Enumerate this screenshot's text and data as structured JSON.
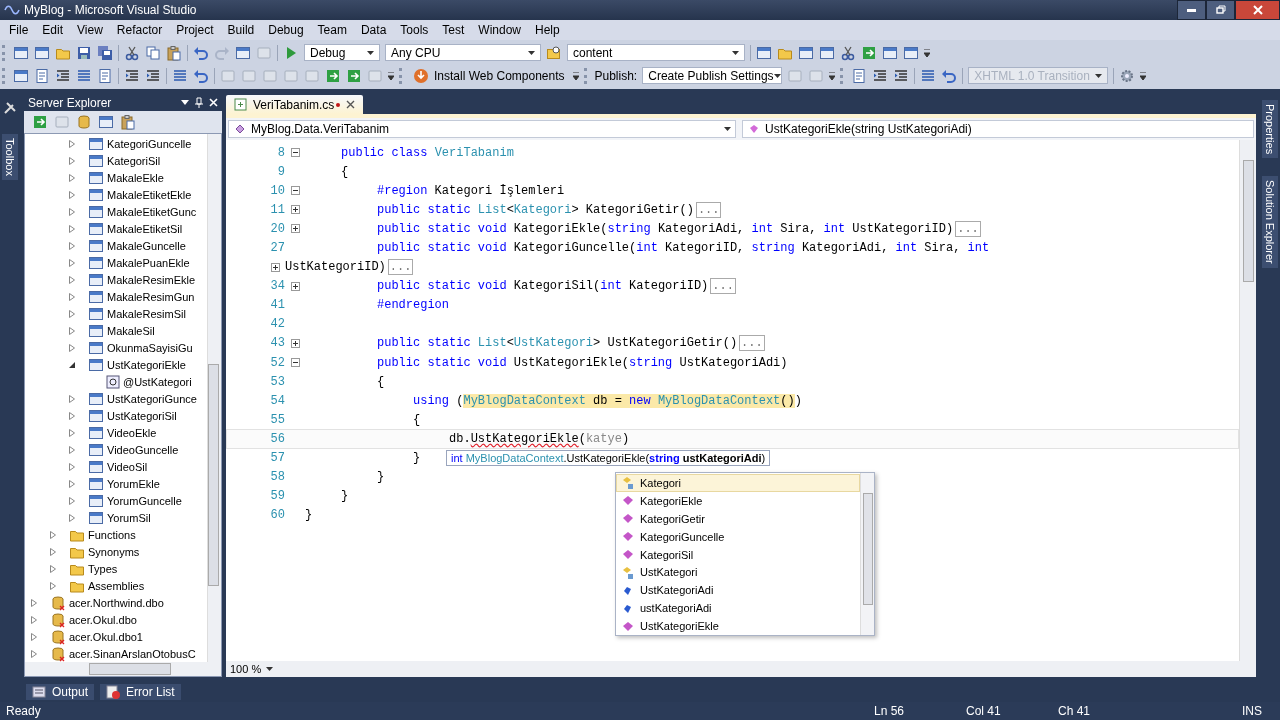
{
  "window": {
    "title": "MyBlog - Microsoft Visual Studio"
  },
  "menu": [
    "File",
    "Edit",
    "View",
    "Refactor",
    "Project",
    "Build",
    "Debug",
    "Team",
    "Data",
    "Tools",
    "Test",
    "Window",
    "Help"
  ],
  "toolbar": {
    "configuration": "Debug",
    "platform": "Any CPU",
    "find": "content",
    "install_button": "Install Web Components",
    "publish_label": "Publish:",
    "publish_settings": "Create Publish Settings",
    "doctype": {
      "value": "XHTML 1.0 Transition",
      "disabled": true
    }
  },
  "side_tabs": {
    "left": [
      "Toolbox"
    ],
    "right": [
      "Properties",
      "Solution Explorer"
    ]
  },
  "server_explorer": {
    "title": "Server Explorer",
    "procedures": [
      {
        "label": "KategoriGuncelle",
        "expanded": false
      },
      {
        "label": "KategoriSil",
        "expanded": false
      },
      {
        "label": "MakaleEkle",
        "expanded": false
      },
      {
        "label": "MakaleEtiketEkle",
        "expanded": false
      },
      {
        "label": "MakaleEtiketGunc",
        "expanded": false
      },
      {
        "label": "MakaleEtiketSil",
        "expanded": false
      },
      {
        "label": "MakaleGuncelle",
        "expanded": false
      },
      {
        "label": "MakalePuanEkle",
        "expanded": false
      },
      {
        "label": "MakaleResimEkle",
        "expanded": false
      },
      {
        "label": "MakaleResimGun",
        "expanded": false
      },
      {
        "label": "MakaleResimSil",
        "expanded": false
      },
      {
        "label": "MakaleSil",
        "expanded": false
      },
      {
        "label": "OkunmaSayisiGu",
        "expanded": false
      },
      {
        "label": "UstKategoriEkle",
        "expanded": true,
        "children": [
          {
            "label": "@UstKategori"
          }
        ]
      },
      {
        "label": "UstKategoriGunce",
        "expanded": false
      },
      {
        "label": "UstKategoriSil",
        "expanded": false
      },
      {
        "label": "VideoEkle",
        "expanded": false
      },
      {
        "label": "VideoGuncelle",
        "expanded": false
      },
      {
        "label": "VideoSil",
        "expanded": false
      },
      {
        "label": "YorumEkle",
        "expanded": false
      },
      {
        "label": "YorumGuncelle",
        "expanded": false
      },
      {
        "label": "YorumSil",
        "expanded": false
      }
    ],
    "folders": [
      {
        "label": "Functions",
        "expanded": false
      },
      {
        "label": "Synonyms",
        "expanded": false
      },
      {
        "label": "Types",
        "expanded": false
      },
      {
        "label": "Assemblies",
        "expanded": false
      }
    ],
    "connections": [
      {
        "label": "acer.Northwind.dbo",
        "expanded": false
      },
      {
        "label": "acer.Okul.dbo",
        "expanded": false
      },
      {
        "label": "acer.Okul.dbo1",
        "expanded": false
      },
      {
        "label": "acer.SinanArslanOtobusC",
        "expanded": false
      }
    ]
  },
  "document_tab": {
    "label": "VeriTabanim.cs",
    "modified": true
  },
  "navigation": {
    "type": "MyBlog.Data.VeriTabanim",
    "member": "UstKategoriEkle(string UstKategoriAdi)"
  },
  "code_lines": [
    {
      "number": "8",
      "kind": "fold-open",
      "current": false,
      "tokens": [
        {
          "kind": "keyword",
          "text": "     public class "
        },
        {
          "kind": "type",
          "text": "VeriTabanim"
        }
      ]
    },
    {
      "number": "9",
      "kind": "plain",
      "current": false,
      "tokens": [
        {
          "kind": "plain",
          "text": "     {"
        }
      ]
    },
    {
      "number": "10",
      "kind": "fold-open",
      "current": false,
      "tokens": [
        {
          "kind": "keyword",
          "text": "          #region"
        },
        {
          "kind": "plain",
          "text": " Kategori İşlemleri"
        }
      ]
    },
    {
      "number": "11",
      "kind": "fold-closed",
      "current": false,
      "tokens": [
        {
          "kind": "keyword",
          "text": "          public static "
        },
        {
          "kind": "type",
          "text": "List"
        },
        {
          "kind": "plain",
          "text": "<"
        },
        {
          "kind": "type",
          "text": "Kategori"
        },
        {
          "kind": "plain",
          "text": "> KategoriGetir()"
        },
        {
          "kind": "collapsed",
          "text": "..."
        }
      ]
    },
    {
      "number": "20",
      "kind": "fold-closed",
      "current": false,
      "tokens": [
        {
          "kind": "keyword",
          "text": "          public static void "
        },
        {
          "kind": "plain",
          "text": "KategoriEkle("
        },
        {
          "kind": "keyword",
          "text": "string"
        },
        {
          "kind": "plain",
          "text": " KategoriAdi, "
        },
        {
          "kind": "keyword",
          "text": "int"
        },
        {
          "kind": "plain",
          "text": " Sira, "
        },
        {
          "kind": "keyword",
          "text": "int"
        },
        {
          "kind": "plain",
          "text": " UstKategoriID)"
        },
        {
          "kind": "collapsed",
          "text": "..."
        }
      ]
    },
    {
      "number": "27",
      "kind": "plain",
      "current": false,
      "tokens": [
        {
          "kind": "keyword",
          "text": "          public static void "
        },
        {
          "kind": "plain",
          "text": "KategoriGuncelle("
        },
        {
          "kind": "keyword",
          "text": "int"
        },
        {
          "kind": "plain",
          "text": " KategoriID, "
        },
        {
          "kind": "keyword",
          "text": "string"
        },
        {
          "kind": "plain",
          "text": " KategoriAdi, "
        },
        {
          "kind": "keyword",
          "text": "int"
        },
        {
          "kind": "plain",
          "text": " Sira, "
        },
        {
          "kind": "keyword",
          "text": "int"
        }
      ]
    },
    {
      "kind": "fold-closed",
      "current": false,
      "tokens": [
        {
          "kind": "plain",
          "text": "UstKategoriID)"
        },
        {
          "kind": "collapsed",
          "text": "..."
        }
      ]
    },
    {
      "number": "34",
      "kind": "fold-closed",
      "current": false,
      "tokens": [
        {
          "kind": "keyword",
          "text": "          public static void "
        },
        {
          "kind": "plain",
          "text": "KategoriSil("
        },
        {
          "kind": "keyword",
          "text": "int"
        },
        {
          "kind": "plain",
          "text": " KategoriID)"
        },
        {
          "kind": "collapsed",
          "text": "..."
        }
      ]
    },
    {
      "number": "41",
      "kind": "plain",
      "current": false,
      "tokens": [
        {
          "kind": "keyword",
          "text": "          #endregion"
        }
      ]
    },
    {
      "number": "42",
      "kind": "plain",
      "current": false
    },
    {
      "number": "43",
      "kind": "fold-closed",
      "current": false,
      "tokens": [
        {
          "kind": "keyword",
          "text": "          public static "
        },
        {
          "kind": "type",
          "text": "List"
        },
        {
          "kind": "plain",
          "text": "<"
        },
        {
          "kind": "type",
          "text": "UstKategori"
        },
        {
          "kind": "plain",
          "text": "> UstKategoriGetir()"
        },
        {
          "kind": "collapsed",
          "text": "..."
        }
      ]
    },
    {
      "number": "52",
      "kind": "fold-open",
      "current": false,
      "tokens": [
        {
          "kind": "keyword",
          "text": "          public static void "
        },
        {
          "kind": "plain",
          "text": "UstKategoriEkle("
        },
        {
          "kind": "keyword",
          "text": "string"
        },
        {
          "kind": "plain",
          "text": " UstKategoriAdi)"
        }
      ]
    },
    {
      "number": "53",
      "kind": "plain",
      "current": false,
      "tokens": [
        {
          "kind": "plain",
          "text": "          {"
        }
      ]
    },
    {
      "number": "54",
      "kind": "plain",
      "current": false,
      "tokens": [
        {
          "kind": "keyword",
          "text": "               using"
        },
        {
          "kind": "plain",
          "text": " ("
        },
        {
          "kind": "type-highlighted",
          "text": "MyBlogDataContext"
        },
        {
          "kind": "plain-highlighted",
          "text": " db = "
        },
        {
          "kind": "keyword-highlighted",
          "text": "new"
        },
        {
          "kind": "type-highlighted",
          "text": " MyBlogDataContext"
        },
        {
          "kind": "plain-highlighted",
          "text": "()"
        },
        {
          "kind": "plain",
          "text": ")"
        }
      ]
    },
    {
      "number": "55",
      "kind": "plain",
      "current": false,
      "tokens": [
        {
          "kind": "plain",
          "text": "               {"
        }
      ]
    },
    {
      "number": "56",
      "kind": "plain",
      "current": true,
      "tokens": [
        {
          "kind": "plain",
          "text": "                    db."
        },
        {
          "kind": "error",
          "text": "UstKategoriEkle"
        },
        {
          "kind": "plain",
          "text": "("
        },
        {
          "kind": "typed",
          "text": "katye"
        },
        {
          "kind": "plain",
          "text": ")"
        }
      ]
    },
    {
      "number": "57",
      "kind": "plain",
      "current": false,
      "tokens": [
        {
          "kind": "plain",
          "text": "               }"
        }
      ]
    },
    {
      "number": "58",
      "kind": "plain",
      "current": false,
      "tokens": [
        {
          "kind": "plain",
          "text": "          }"
        }
      ]
    },
    {
      "number": "59",
      "kind": "plain",
      "current": false,
      "tokens": [
        {
          "kind": "plain",
          "text": "     }"
        }
      ]
    },
    {
      "number": "60",
      "kind": "plain",
      "current": false,
      "tokens": [
        {
          "kind": "plain",
          "text": "}"
        }
      ]
    }
  ],
  "parameter_tooltip": {
    "tokens": [
      {
        "kind": "keyword",
        "text": "int "
      },
      {
        "kind": "type",
        "text": "MyBlogDataContext"
      },
      {
        "kind": "plain",
        "text": ".UstKategoriEkle("
      },
      {
        "kind": "param-keyword",
        "text": "string"
      },
      {
        "kind": "param",
        "text": " ustKategoriAdi"
      },
      {
        "kind": "plain",
        "text": ")"
      }
    ]
  },
  "completion_list": [
    {
      "label": "Kategori",
      "kind": "class",
      "selected": true
    },
    {
      "label": "KategoriEkle",
      "kind": "method",
      "selected": false
    },
    {
      "label": "KategoriGetir",
      "kind": "method",
      "selected": false
    },
    {
      "label": "KategoriGuncelle",
      "kind": "method",
      "selected": false
    },
    {
      "label": "KategoriSil",
      "kind": "method",
      "selected": false
    },
    {
      "label": "UstKategori",
      "kind": "class",
      "selected": false
    },
    {
      "label": "UstKategoriAdi",
      "kind": "field",
      "selected": false
    },
    {
      "label": "ustKategoriAdi",
      "kind": "field",
      "selected": false
    },
    {
      "label": "UstKategoriEkle",
      "kind": "method",
      "selected": false
    }
  ],
  "zoom": "100 %",
  "bottom_tabs": [
    "Output",
    "Error List"
  ],
  "status_bar": {
    "message": "Ready",
    "line": "Ln 56",
    "column": "Col 41",
    "char": "Ch 41",
    "mode": "INS"
  }
}
